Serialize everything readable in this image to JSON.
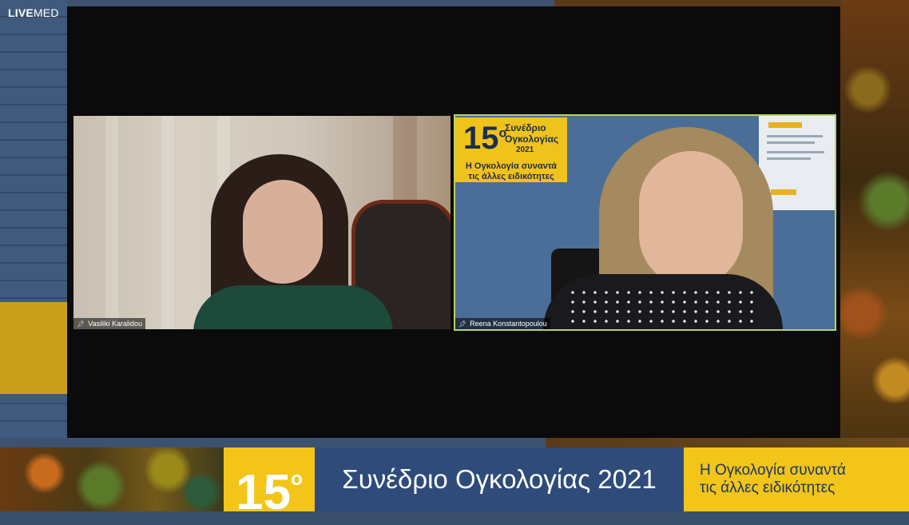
{
  "brand": {
    "logo_live": "LIVE",
    "logo_med": "MED"
  },
  "participants": [
    {
      "name": "Vasiliki Karalidou"
    },
    {
      "name": "Reena Konstantopoulou"
    }
  ],
  "slide_banner": {
    "number": "15",
    "superscript": "o",
    "title_line1": "Συνέδριο",
    "title_line2": "Ογκολογίας",
    "year": "2021",
    "subtitle_line1": "Η Ογκολογία συναντά",
    "subtitle_line2": "τις άλλες ειδικότητες"
  },
  "lower_third": {
    "number": "15",
    "superscript": "o",
    "title": "Συνέδριο Ογκολογίας 2021",
    "subtitle_line1": "Η Ογκολογία συναντά",
    "subtitle_line2": "τις άλλες ειδικότητες"
  },
  "colors": {
    "accent_gold": "#f2c518",
    "navy": "#2e4b7a",
    "active_speaker_border": "#b9d45a"
  }
}
